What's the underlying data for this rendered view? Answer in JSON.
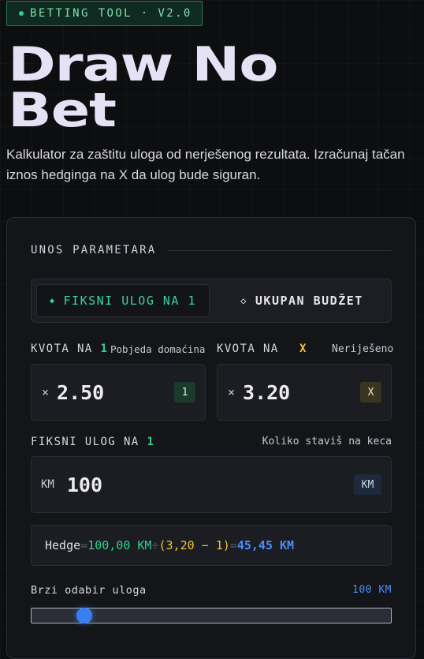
{
  "badge": "BETTING TOOL · V2.0",
  "hero": {
    "line1": "Draw No",
    "line2": "Bet"
  },
  "intro": "Kalkulator za zaštitu uloga od nerješenog rezultata. Izračunaj tačan iznos hedginga na X da ulog bude siguran.",
  "section_title": "UNOS PARAMETARA",
  "mode_toggle": {
    "active": {
      "icon": "◆",
      "label": "FIKSNI ULOG NA 1"
    },
    "inactive": {
      "icon": "◇",
      "label": "UKUPAN BUDŽET"
    }
  },
  "odds_home": {
    "label": "KVOTA NA",
    "tag": "1",
    "sub": "Pobjeda domaćina",
    "prefix": "×",
    "value": "2.50",
    "chip": "1"
  },
  "odds_draw": {
    "label": "KVOTA NA",
    "tag": "X",
    "sub": "Neriješeno",
    "prefix": "×",
    "value": "3.20",
    "chip": "X"
  },
  "stake": {
    "label": "FIKSNI ULOG NA",
    "tag": "1",
    "sub": "Koliko staviš na keca",
    "prefix": "KM",
    "value": "100",
    "chip": "KM"
  },
  "formula": {
    "label": "Hedge",
    "eq1": "=",
    "stake": "100,00 KM",
    "div": "÷",
    "expr": "(3,20 − 1)",
    "eq2": "=",
    "result": "45,45 KM"
  },
  "quick_pick": {
    "label": "Brzi odabir uloga",
    "value": "100 KM",
    "level": 0.13
  },
  "colors": {
    "accent_green": "#2fd18a",
    "accent_yellow": "#f2c230",
    "accent_blue": "#4a8cf7"
  }
}
